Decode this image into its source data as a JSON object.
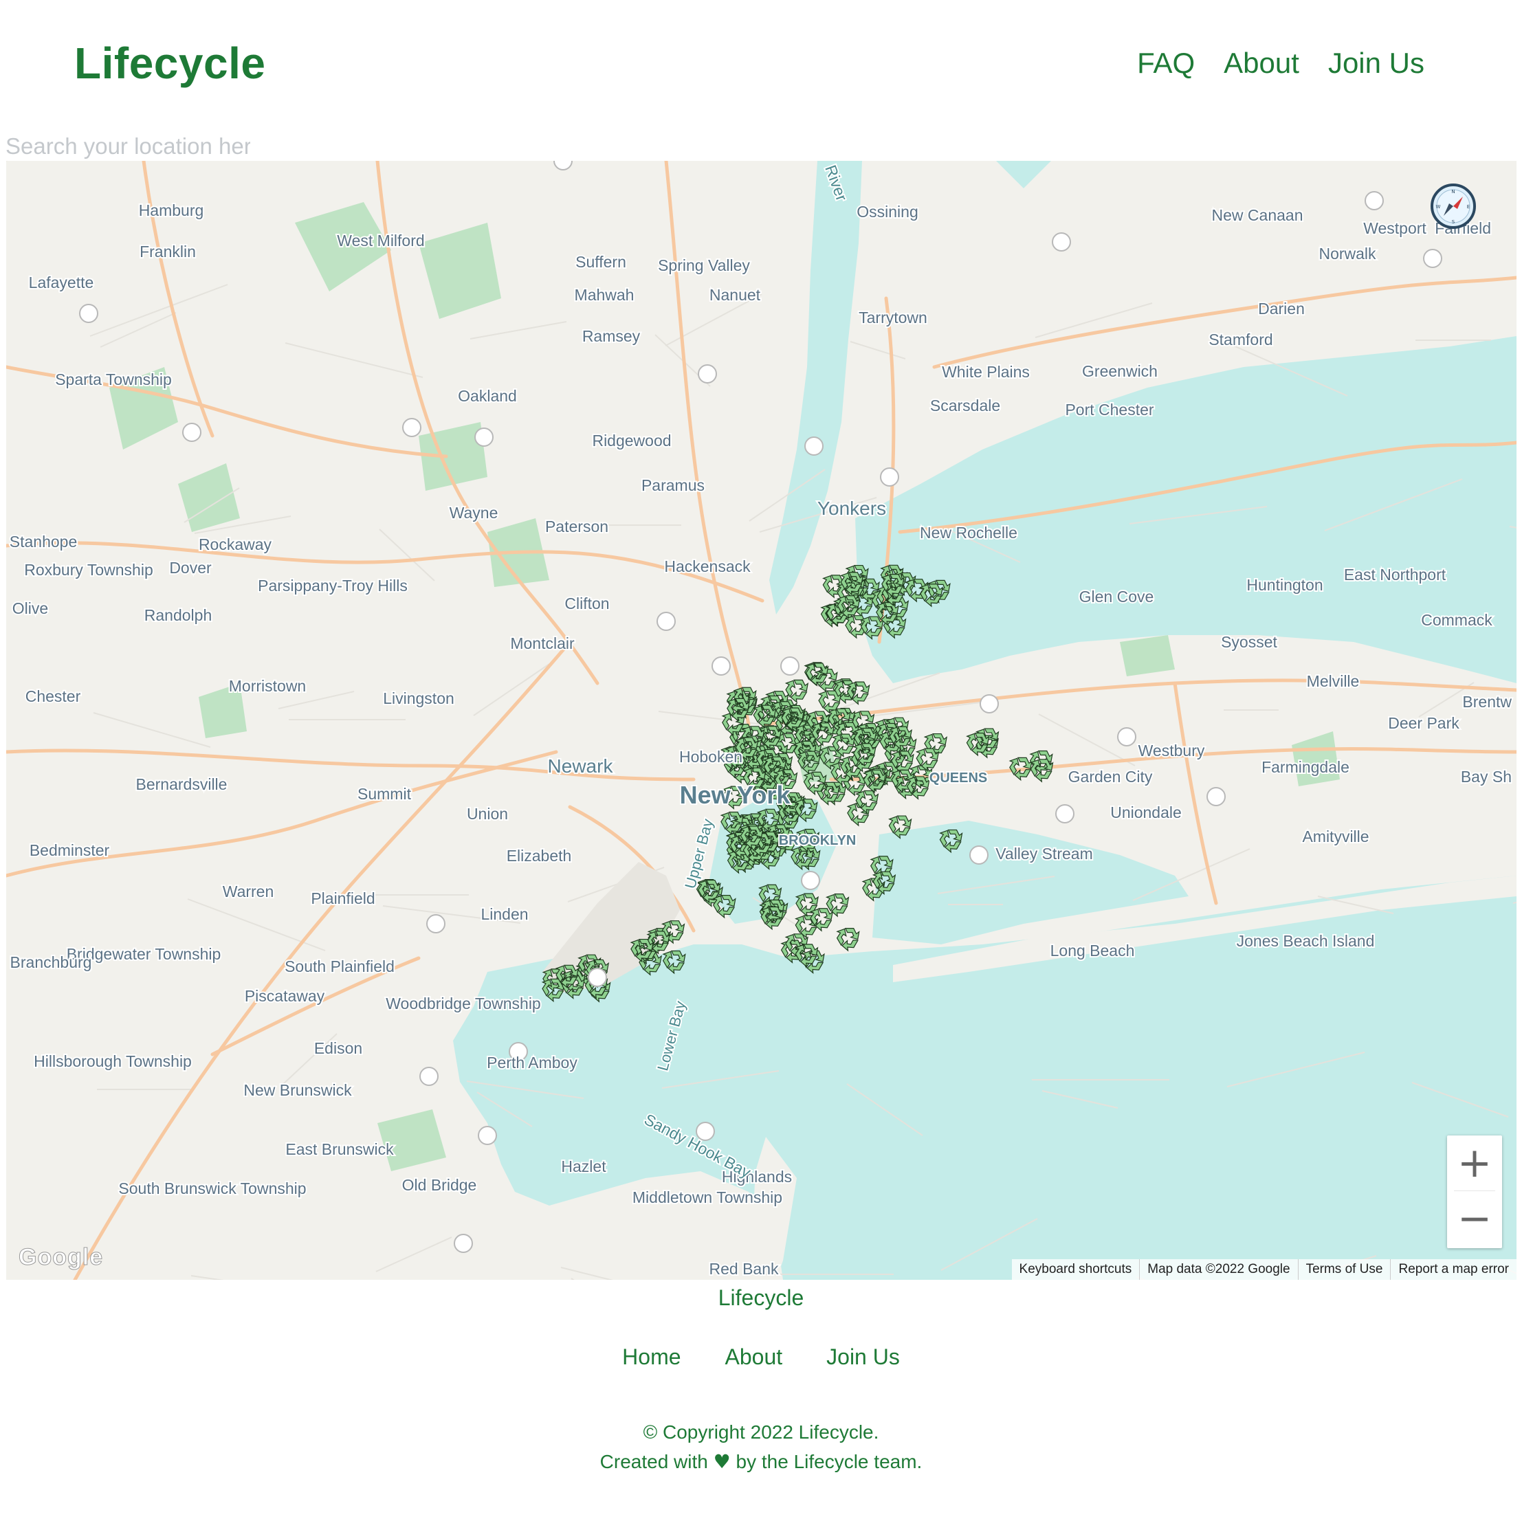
{
  "header": {
    "brand": "Lifecycle",
    "nav": [
      "FAQ",
      "About",
      "Join Us"
    ]
  },
  "search": {
    "placeholder": "Search your location her"
  },
  "map": {
    "attribution": [
      "Keyboard shortcuts",
      "Map data ©2022 Google",
      "Terms of Use",
      "Report a map error"
    ],
    "logo": "Google",
    "zoom_in": "+",
    "zoom_out": "−",
    "colors": {
      "land": "#f2f1ec",
      "water": "#c4ece9",
      "park": "#bfe3c4",
      "highway": "#f7c8a0",
      "marker": "#8fd18f"
    },
    "labels": {
      "major": [
        "Newark",
        "New York",
        "Yonkers",
        "QUEENS",
        "BROOKLYN"
      ],
      "cities": [
        "Hamburg",
        "Franklin",
        "Lafayette",
        "West Milford",
        "Suffern",
        "Spring Valley",
        "Mahwah",
        "Nanuet",
        "Ossining",
        "Tarrytown",
        "Ramsey",
        "Oakland",
        "Ridgewood",
        "Paramus",
        "Wayne",
        "Paterson",
        "Hackensack",
        "Clifton",
        "Montclair",
        "Livingston",
        "Morristown",
        "Chester",
        "Summit",
        "Union",
        "Elizabeth",
        "Linden",
        "Rockaway",
        "Dover",
        "Randolph",
        "Parsippany-Troy Hills",
        "Stanhope",
        "Roxbury Township",
        "Olive",
        "Bernardsville",
        "Bedminster",
        "Warren",
        "Plainfield",
        "South Plainfield",
        "Bridgewater Township",
        "Branchburg",
        "Piscataway",
        "Edison",
        "Woodbridge Township",
        "Perth Amboy",
        "New Brunswick",
        "East Brunswick",
        "South Brunswick Township",
        "Hillsborough Township",
        "Old Bridge",
        "Hazlet",
        "Middletown Township",
        "Highlands",
        "Red Bank",
        "Sparta Township",
        "New Canaan",
        "Westport",
        "Fairfield",
        "Norwalk",
        "Darien",
        "Stamford",
        "Greenwich",
        "White Plains",
        "Scarsdale",
        "Port Chester",
        "New Rochelle",
        "Glen Cove",
        "Huntington",
        "East Northport",
        "Commack",
        "Syosset",
        "Melville",
        "Deer Park",
        "Westbury",
        "Garden City",
        "Farmingdale",
        "Uniondale",
        "Amityville",
        "Valley Stream",
        "Long Beach",
        "Jones Beach Island",
        "Bay Sh",
        "Brentw",
        "Hoboken"
      ],
      "water": [
        "Upper Bay",
        "Lower Bay",
        "Sandy Hook Bay",
        "River"
      ]
    },
    "marker_count": 220
  },
  "footer": {
    "title": "Lifecycle",
    "nav": [
      "Home",
      "About",
      "Join Us"
    ],
    "copyright": "© Copyright 2022 Lifecycle.",
    "created_prefix": "Created with",
    "created_suffix": "by the Lifecycle team."
  }
}
